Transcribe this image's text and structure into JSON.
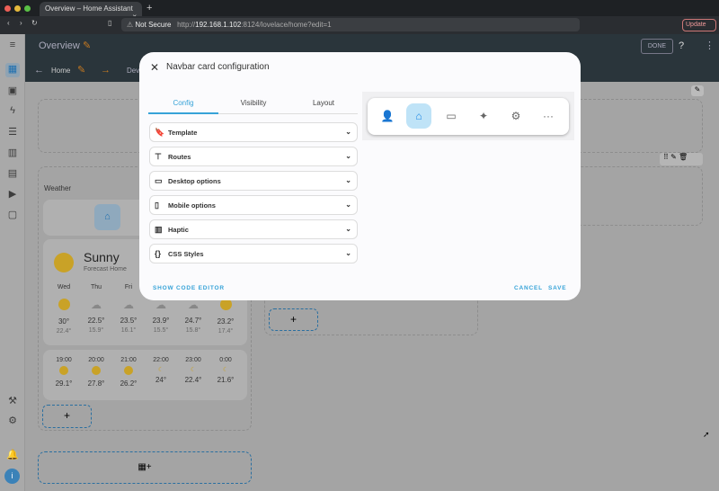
{
  "browser": {
    "tab_title": "Overview – Home Assistant",
    "security": "Not Secure",
    "url_host": "192.168.1.102",
    "url_rest": ":8124/lovelace/home?edit=1",
    "url_prefix": "http://",
    "update_label": "Update"
  },
  "header": {
    "title": "Overview",
    "done_label": "DONE",
    "views": [
      "Home",
      "Devi"
    ]
  },
  "weather": {
    "section_title": "Weather",
    "condition": "Sunny",
    "subtitle": "Forecast Home",
    "daily": [
      {
        "day": "Wed",
        "high": "30°",
        "low": "22.4°"
      },
      {
        "day": "Thu",
        "high": "22.5°",
        "low": "15.9°"
      },
      {
        "day": "Fri",
        "high": "23.5°",
        "low": "16.1°"
      },
      {
        "day": "",
        "high": "23.9°",
        "low": "15.5°"
      },
      {
        "day": "",
        "high": "24.7°",
        "low": "15.8°"
      },
      {
        "day": "",
        "high": "23.2°",
        "low": "17.4°"
      }
    ],
    "hourly": [
      {
        "time": "19:00",
        "temp": "29.1°"
      },
      {
        "time": "20:00",
        "temp": "27.8°"
      },
      {
        "time": "21:00",
        "temp": "26.2°"
      },
      {
        "time": "22:00",
        "temp": "24°"
      },
      {
        "time": "23:00",
        "temp": "22.4°"
      },
      {
        "time": "0:00",
        "temp": "21.6°"
      }
    ]
  },
  "add_label": "+",
  "dialog": {
    "title": "Navbar card configuration",
    "tabs": [
      "Config",
      "Visibility",
      "Layout"
    ],
    "panels": [
      "Template",
      "Routes",
      "Desktop options",
      "Mobile options",
      "Haptic",
      "CSS Styles"
    ],
    "show_code": "SHOW CODE EDITOR",
    "cancel": "CANCEL",
    "save": "SAVE"
  },
  "colors": {
    "accent": "#37a3d8",
    "header": "#2a353b"
  }
}
